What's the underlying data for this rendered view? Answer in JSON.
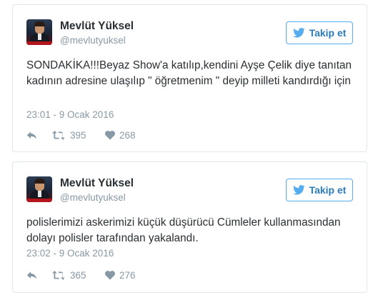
{
  "follow_label": "Takip et",
  "colors": {
    "accent": "#55acee",
    "text": "#292f33",
    "muted": "#8899a6",
    "border": "#e1e8ed"
  },
  "icons": {
    "follow": "bird-icon",
    "reply": "reply-icon",
    "retweet": "retweet-icon",
    "like": "heart-icon"
  },
  "tweets": [
    {
      "name": "Mevlüt Yüksel",
      "handle": "@mevlutyuksel",
      "text": "SONDAKİKA!!!Beyaz Show'a katılıp,kendini Ayşe Çelik diye tanıtan kadının adresine ulaşılıp \" öğretmenim \" deyip milleti kandırdığı için",
      "timestamp": "23:01 - 9 Ocak 2016",
      "retweets": "395",
      "likes": "268"
    },
    {
      "name": "Mevlüt Yüksel",
      "handle": "@mevlutyuksel",
      "text": "polislerimizi askerimizi küçük düşürücü Cümleler kullanmasından dolayı polisler tarafından yakalandı.",
      "timestamp": "23:02 - 9 Ocak 2016",
      "retweets": "365",
      "likes": "276"
    }
  ]
}
